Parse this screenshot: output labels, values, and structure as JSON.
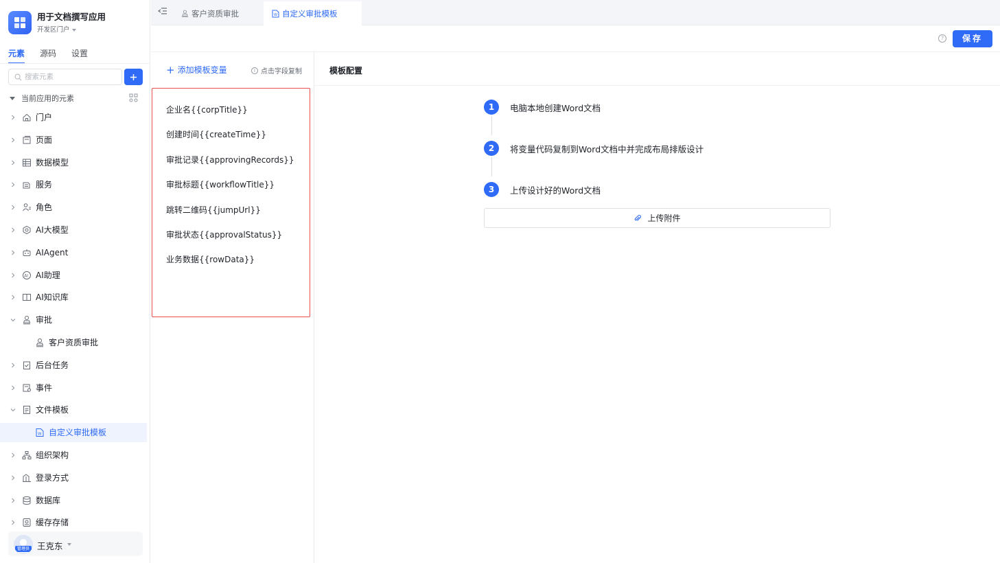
{
  "app": {
    "title": "用于文档撰写应用",
    "portal": "开发区门户"
  },
  "sidebar": {
    "tabs": [
      "元素",
      "源码",
      "设置"
    ],
    "search_placeholder": "搜索元素",
    "section_label": "当前应用的元素",
    "items": [
      {
        "label": "门户",
        "icon": "home-icon"
      },
      {
        "label": "页面",
        "icon": "page-icon"
      },
      {
        "label": "数据模型",
        "icon": "table-icon"
      },
      {
        "label": "服务",
        "icon": "service-icon"
      },
      {
        "label": "角色",
        "icon": "role-icon"
      },
      {
        "label": "AI大模型",
        "icon": "model-icon"
      },
      {
        "label": "AIAgent",
        "icon": "robot-icon"
      },
      {
        "label": "AI助理",
        "icon": "ai-assistant-icon"
      },
      {
        "label": "AI知识库",
        "icon": "book-icon"
      },
      {
        "label": "审批",
        "icon": "approval-icon",
        "expanded": true
      },
      {
        "label": "客户资质审批",
        "icon": "approval-icon",
        "child": true
      },
      {
        "label": "后台任务",
        "icon": "task-icon"
      },
      {
        "label": "事件",
        "icon": "event-icon"
      },
      {
        "label": "文件模板",
        "icon": "file-template-icon",
        "expanded": true
      },
      {
        "label": "自定义审批模板",
        "icon": "word-file-icon",
        "child": true,
        "selected": true
      },
      {
        "label": "组织架构",
        "icon": "org-icon"
      },
      {
        "label": "登录方式",
        "icon": "login-icon"
      },
      {
        "label": "数据库",
        "icon": "database-icon"
      },
      {
        "label": "缓存存储",
        "icon": "cache-icon"
      }
    ],
    "user": {
      "name": "王克东",
      "role_badge": "管理员"
    }
  },
  "page_tabs": [
    {
      "label": "客户资质审批",
      "icon": "approval-icon"
    },
    {
      "label": "自定义审批模板",
      "icon": "word-file-icon",
      "active": true
    }
  ],
  "toolbar": {
    "help": "?",
    "save_label": "保存"
  },
  "variables": {
    "add_label": "添加模板变量",
    "hint": "点击字段复制",
    "items": [
      "企业名{{corpTitle}}",
      "创建时间{{createTime}}",
      "审批记录{{approvingRecords}}",
      "审批标题{{workflowTitle}}",
      "跳转二维码{{jumpUrl}}",
      "审批状态{{approvalStatus}}",
      "业务数据{{rowData}}"
    ]
  },
  "config": {
    "title": "模板配置",
    "steps": [
      {
        "num": "1",
        "text": "电脑本地创建Word文档"
      },
      {
        "num": "2",
        "text": "将变量代码复制到Word文档中并完成布局排版设计"
      },
      {
        "num": "3",
        "text": "上传设计好的Word文档"
      }
    ],
    "upload_label": "上传附件"
  }
}
